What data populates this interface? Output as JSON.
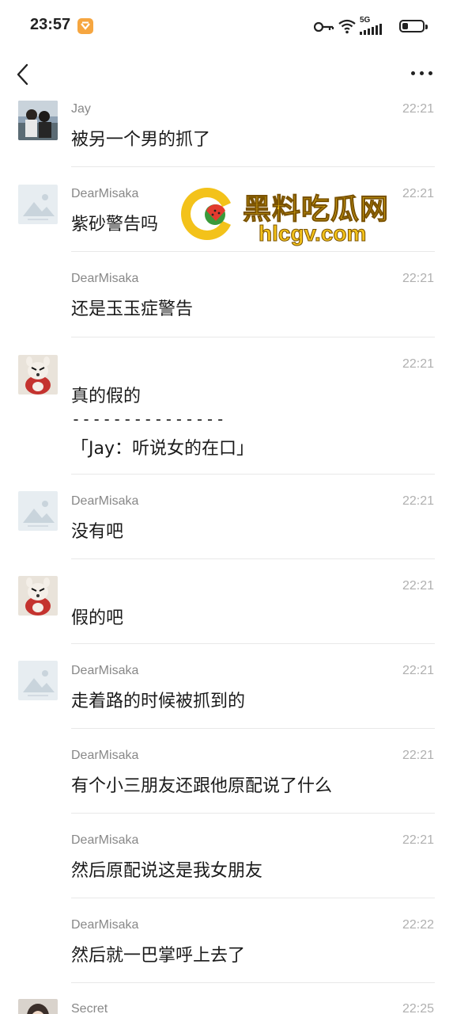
{
  "status_bar": {
    "time": "23:57",
    "network": "5G"
  },
  "messages": [
    {
      "sender": "Jay",
      "time": "22:21",
      "text": "被另一个男的抓了",
      "avatar": "photo"
    },
    {
      "sender": "DearMisaka",
      "time": "22:21",
      "text": "紫砂警告吗",
      "avatar": "placeholder"
    },
    {
      "sender": "DearMisaka",
      "time": "22:21",
      "text": "还是玉玉症警告",
      "avatar": ""
    },
    {
      "sender": "",
      "time": "22:21",
      "text": "真的假的",
      "quote_separator": "---------------",
      "quote": "「Jay：听说女的在口」",
      "avatar": "bear"
    },
    {
      "sender": "DearMisaka",
      "time": "22:21",
      "text": "没有吧",
      "avatar": "placeholder"
    },
    {
      "sender": "",
      "time": "22:21",
      "text": "假的吧",
      "avatar": "bear"
    },
    {
      "sender": "DearMisaka",
      "time": "22:21",
      "text": "走着路的时候被抓到的",
      "avatar": "placeholder"
    },
    {
      "sender": "DearMisaka",
      "time": "22:21",
      "text": "有个小三朋友还跟他原配说了什么",
      "avatar": ""
    },
    {
      "sender": "DearMisaka",
      "time": "22:21",
      "text": "然后原配说这是我女朋友",
      "avatar": ""
    },
    {
      "sender": "DearMisaka",
      "time": "22:22",
      "text": "然后就一巴掌呼上去了",
      "avatar": ""
    },
    {
      "sender": "Secret",
      "time": "22:25",
      "text": "",
      "avatar": "photo2"
    }
  ],
  "watermark": {
    "title": "黑料吃瓜网",
    "url": "hlcgv.com"
  },
  "colors": {
    "accent_orange": "#f6a640",
    "watermark_yellow": "#f3c21a",
    "divider": "#e8e8e8",
    "time_gray": "#b0b0b0",
    "sender_gray": "#888888"
  },
  "icons": {
    "back": "chevron-left-icon",
    "more": "more-dots-icon",
    "key": "key-icon",
    "wifi": "wifi-icon",
    "signal": "signal-icon",
    "battery": "battery-icon"
  }
}
